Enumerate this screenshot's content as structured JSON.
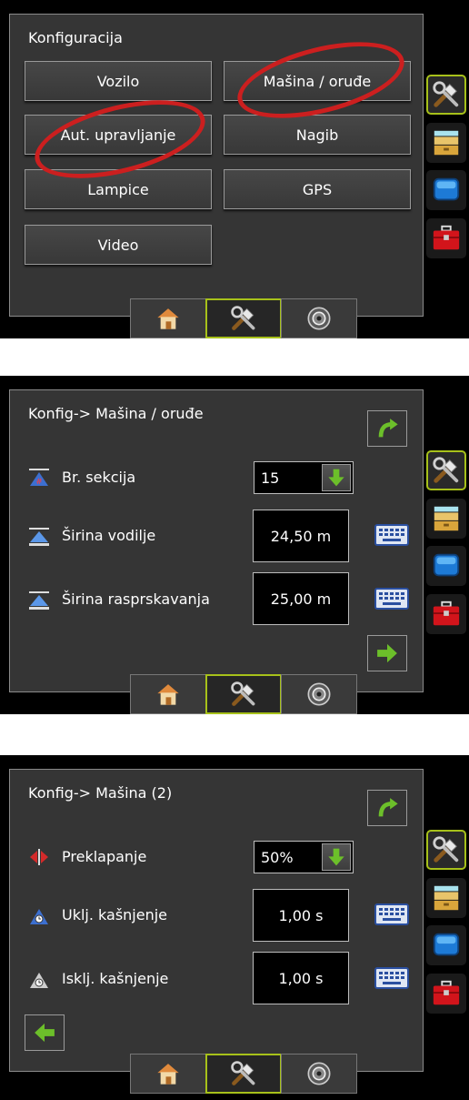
{
  "screen1": {
    "title": "Konfiguracija",
    "buttons": [
      "Vozilo",
      "Mašina / oruđe",
      "Aut. upravljanje",
      "Nagib",
      "Lampice",
      "GPS",
      "Video"
    ],
    "highlight_color": "#cc1f1f"
  },
  "screen2": {
    "title": "Konfig-> Mašina / oruđe",
    "rows": [
      {
        "label": "Br. sekcija",
        "value": "15",
        "control": "dropdown"
      },
      {
        "label": "Širina vodilje",
        "value": "24,50 m",
        "control": "keyboard"
      },
      {
        "label": "Širina rasprskavanja",
        "value": "25,00 m",
        "control": "keyboard"
      }
    ]
  },
  "screen3": {
    "title": "Konfig-> Mašina (2)",
    "rows": [
      {
        "label": "Preklapanje",
        "value": "50%",
        "control": "dropdown"
      },
      {
        "label": "Uklj. kašnjenje",
        "value": "1,00 s",
        "control": "keyboard"
      },
      {
        "label": "Isklj. kašnjenje",
        "value": "1,00 s",
        "control": "keyboard"
      }
    ]
  },
  "icons": {
    "sidebar": [
      "tools-icon",
      "storage-icon",
      "screen-icon",
      "toolbox-icon"
    ],
    "bottom_tabs": [
      "home-icon",
      "tools-icon",
      "guidance-icon"
    ]
  },
  "colors": {
    "accent": "#a7c11a",
    "panel": "#353535",
    "green_arrow": "#6cbf2a"
  }
}
